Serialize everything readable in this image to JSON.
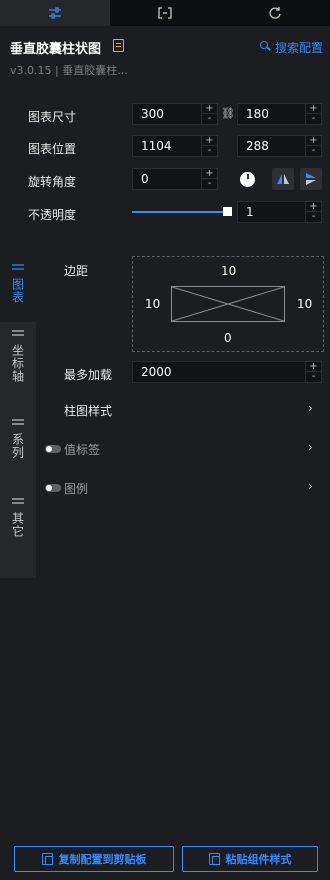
{
  "tabs": [
    {
      "icon": "sliders-icon"
    },
    {
      "icon": "bracket-icon"
    },
    {
      "icon": "rotate-icon"
    }
  ],
  "header": {
    "title": "垂直胶囊柱状图",
    "search_label": "搜索配置",
    "version": "v3.0.15 | 垂直胶囊柱..."
  },
  "props": {
    "size": {
      "label": "图表尺寸",
      "width": "300",
      "height": "180"
    },
    "position": {
      "label": "图表位置",
      "x": "1104",
      "y": "288"
    },
    "rotation": {
      "label": "旋转角度",
      "value": "0"
    },
    "opacity": {
      "label": "不透明度",
      "value": "1",
      "level": 1
    }
  },
  "sidebar": [
    {
      "label": "图表",
      "active": true
    },
    {
      "label": "坐标轴",
      "active": false
    },
    {
      "label": "系列",
      "active": false
    },
    {
      "label": "其它",
      "active": false
    }
  ],
  "margin": {
    "label": "边距",
    "top": "10",
    "left": "10",
    "right": "10",
    "bottom": "0"
  },
  "max_load": {
    "label": "最多加载",
    "value": "2000"
  },
  "sections": [
    {
      "label": "柱图样式"
    },
    {
      "label": "值标签"
    },
    {
      "label": "图例"
    }
  ],
  "buttons": {
    "copy": "复制配置到剪贴板",
    "paste": "粘贴组件样式"
  },
  "colors": {
    "accent": "#2f8bff",
    "title_icon": "#f5a623",
    "background": "#1c1d20"
  }
}
